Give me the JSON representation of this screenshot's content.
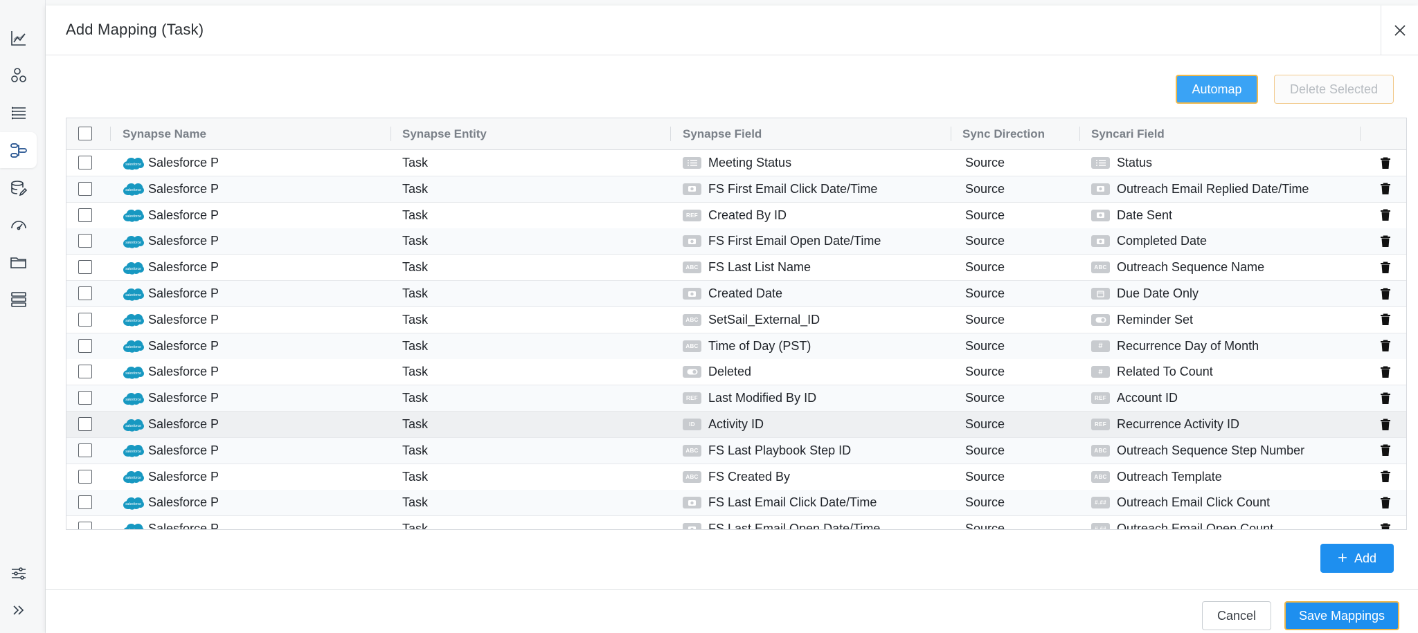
{
  "nav": {
    "items": [
      {
        "icon": "analytics-chart-icon",
        "active": false
      },
      {
        "icon": "entity-network-icon",
        "active": false
      },
      {
        "icon": "list-view-icon",
        "active": false
      },
      {
        "icon": "mapping-flow-icon",
        "active": true
      },
      {
        "icon": "database-edit-icon",
        "active": false
      },
      {
        "icon": "dashboard-gauge-icon",
        "active": false
      },
      {
        "icon": "folder-icon",
        "active": false
      },
      {
        "icon": "stacked-records-icon",
        "active": false
      }
    ],
    "bottom_items": [
      {
        "icon": "settings-sliders-icon"
      },
      {
        "icon": "expand-chevrons-icon"
      }
    ]
  },
  "modal": {
    "title": "Add Mapping (Task)",
    "automap_label": "Automap",
    "delete_selected_label": "Delete Selected",
    "add_label": "Add",
    "cancel_label": "Cancel",
    "save_label": "Save Mappings"
  },
  "table": {
    "columns": [
      "Synapse Name",
      "Synapse Entity",
      "Synapse Field",
      "Sync Direction",
      "Syncari Field"
    ],
    "rows": [
      {
        "name": "Salesforce P",
        "entity": "Task",
        "field_type": "list",
        "field": "Meeting Status",
        "direction": "Source",
        "syncari_type": "list",
        "syncari_field": "Status"
      },
      {
        "name": "Salesforce P",
        "entity": "Task",
        "field_type": "datetime",
        "field": "FS First Email Click Date/Time",
        "direction": "Source",
        "syncari_type": "datetime",
        "syncari_field": "Outreach Email Replied Date/Time"
      },
      {
        "name": "Salesforce P",
        "entity": "Task",
        "field_type": "REF",
        "field": "Created By ID",
        "direction": "Source",
        "syncari_type": "datetime",
        "syncari_field": "Date Sent"
      },
      {
        "name": "Salesforce P",
        "entity": "Task",
        "field_type": "datetime",
        "field": "FS First Email Open Date/Time",
        "direction": "Source",
        "syncari_type": "datetime",
        "syncari_field": "Completed Date"
      },
      {
        "name": "Salesforce P",
        "entity": "Task",
        "field_type": "ABC",
        "field": "FS Last List Name",
        "direction": "Source",
        "syncari_type": "ABC",
        "syncari_field": "Outreach Sequence Name"
      },
      {
        "name": "Salesforce P",
        "entity": "Task",
        "field_type": "datetime",
        "field": "Created Date",
        "direction": "Source",
        "syncari_type": "date",
        "syncari_field": "Due Date Only"
      },
      {
        "name": "Salesforce P",
        "entity": "Task",
        "field_type": "ABC",
        "field": "SetSail_External_ID",
        "direction": "Source",
        "syncari_type": "toggle",
        "syncari_field": "Reminder Set"
      },
      {
        "name": "Salesforce P",
        "entity": "Task",
        "field_type": "ABC",
        "field": "Time of Day (PST)",
        "direction": "Source",
        "syncari_type": "#",
        "syncari_field": "Recurrence Day of Month"
      },
      {
        "name": "Salesforce P",
        "entity": "Task",
        "field_type": "toggle",
        "field": "Deleted",
        "direction": "Source",
        "syncari_type": "#",
        "syncari_field": "Related To Count"
      },
      {
        "name": "Salesforce P",
        "entity": "Task",
        "field_type": "REF",
        "field": "Last Modified By ID",
        "direction": "Source",
        "syncari_type": "REF",
        "syncari_field": "Account ID"
      },
      {
        "name": "Salesforce P",
        "entity": "Task",
        "field_type": "ID",
        "field": "Activity ID",
        "direction": "Source",
        "syncari_type": "REF",
        "syncari_field": "Recurrence Activity ID"
      },
      {
        "name": "Salesforce P",
        "entity": "Task",
        "field_type": "ABC",
        "field": "FS Last Playbook Step ID",
        "direction": "Source",
        "syncari_type": "ABC",
        "syncari_field": "Outreach Sequence Step Number"
      },
      {
        "name": "Salesforce P",
        "entity": "Task",
        "field_type": "ABC",
        "field": "FS Created By",
        "direction": "Source",
        "syncari_type": "ABC",
        "syncari_field": "Outreach Template"
      },
      {
        "name": "Salesforce P",
        "entity": "Task",
        "field_type": "datetime",
        "field": "FS Last Email Click Date/Time",
        "direction": "Source",
        "syncari_type": "#.##",
        "syncari_field": "Outreach Email Click Count"
      },
      {
        "name": "Salesforce P",
        "entity": "Task",
        "field_type": "datetime",
        "field": "FS Last Email Open Date/Time",
        "direction": "Source",
        "syncari_type": "#.##",
        "syncari_field": "Outreach Email Open Count"
      }
    ]
  }
}
